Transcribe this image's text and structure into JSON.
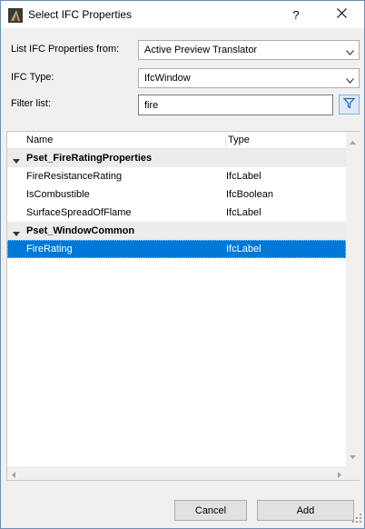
{
  "window": {
    "title": "Select IFC Properties",
    "help_label": "?",
    "icons": {
      "app": "archicad-app-icon",
      "close": "close-icon"
    }
  },
  "form": {
    "list_from_label": "List IFC Properties from:",
    "list_from_value": "Active Preview Translator",
    "ifc_type_label": "IFC Type:",
    "ifc_type_value": "IfcWindow",
    "filter_label": "Filter list:",
    "filter_value": "fire",
    "filter_icon": "funnel-icon"
  },
  "table": {
    "columns": [
      "Name",
      "Type"
    ],
    "rows": [
      {
        "kind": "group",
        "name": "Pset_FireRatingProperties",
        "type": ""
      },
      {
        "kind": "item",
        "name": "FireResistanceRating",
        "type": "IfcLabel"
      },
      {
        "kind": "item",
        "name": "IsCombustible",
        "type": "IfcBoolean"
      },
      {
        "kind": "item",
        "name": "SurfaceSpreadOfFlame",
        "type": "IfcLabel"
      },
      {
        "kind": "group",
        "name": "Pset_WindowCommon",
        "type": ""
      },
      {
        "kind": "item",
        "name": "FireRating",
        "type": "IfcLabel",
        "selected": true
      }
    ]
  },
  "buttons": {
    "cancel": "Cancel",
    "add": "Add"
  },
  "colors": {
    "selection": "#0078d7",
    "group_row": "#ececec"
  }
}
